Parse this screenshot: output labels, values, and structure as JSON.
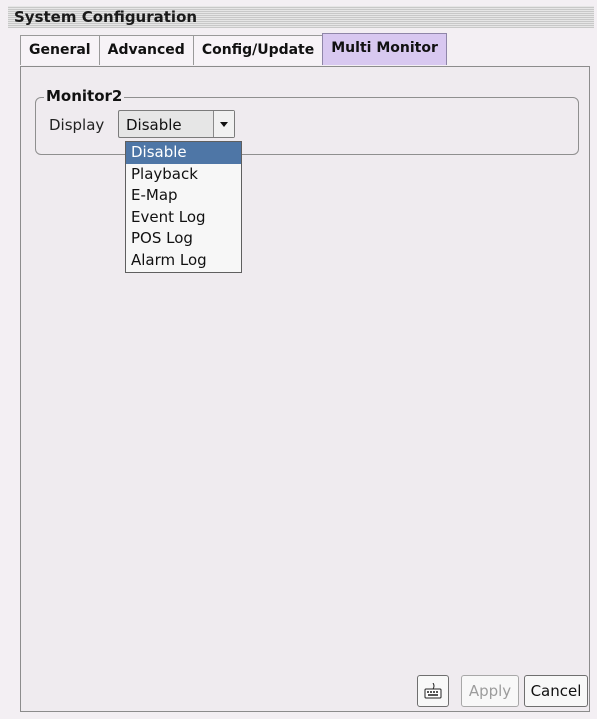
{
  "window": {
    "title": "System Configuration"
  },
  "tabs": [
    {
      "label": "General",
      "active": false
    },
    {
      "label": "Advanced",
      "active": false
    },
    {
      "label": "Config/Update",
      "active": false
    },
    {
      "label": "Multi Monitor",
      "active": true
    }
  ],
  "monitor_group": {
    "title": "Monitor2",
    "display_label": "Display",
    "display_value": "Disable",
    "options": [
      {
        "label": "Disable",
        "selected": true
      },
      {
        "label": "Playback",
        "selected": false
      },
      {
        "label": "E-Map",
        "selected": false
      },
      {
        "label": "Event Log",
        "selected": false
      },
      {
        "label": "POS Log",
        "selected": false
      },
      {
        "label": "Alarm Log",
        "selected": false
      }
    ]
  },
  "footer": {
    "keyboard_icon": "keyboard-icon",
    "apply_label": "Apply",
    "cancel_label": "Cancel"
  },
  "colors": {
    "active_tab": "#d8c8f0",
    "selected_option": "#4e76a6"
  }
}
